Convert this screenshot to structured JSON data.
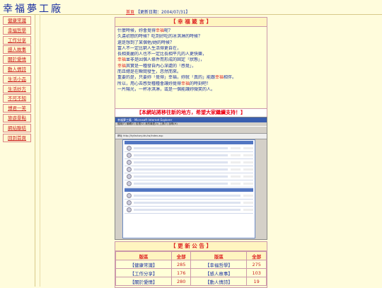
{
  "site": {
    "title": "幸福夢工廠"
  },
  "topbar": {
    "label": "首頁",
    "update": "【更新日期：2004/07/31】"
  },
  "sidebar": {
    "items": [
      {
        "label": "健康常識"
      },
      {
        "label": "幸福哲學"
      },
      {
        "label": "工作分享"
      },
      {
        "label": "感人故事"
      },
      {
        "label": "關於愛情"
      },
      {
        "label": "動人情詩"
      },
      {
        "label": "生活小品"
      },
      {
        "label": "生活妙方"
      },
      {
        "label": "不可不知"
      },
      {
        "label": "博君一笑"
      },
      {
        "label": "旅遊景點"
      },
      {
        "label": "網站聯結"
      },
      {
        "label": "回到首頁"
      }
    ]
  },
  "saying": {
    "title": "【 幸 福 箴 言 】",
    "lines": [
      [
        "什麼時候，妳會覺得",
        "幸福",
        "呢？"
      ],
      [
        "久違初戀的時候？吃到好吃的冰淇淋的時候？",
        "",
        ""
      ],
      [
        "還是想到了某個他/她的時候？",
        "",
        ""
      ],
      [
        "富人不一定比窮人生活得更自在，",
        "",
        ""
      ],
      [
        "長相美麗的人也不一定比長相平凡的人更快樂，",
        "",
        ""
      ],
      [
        "",
        "幸福",
        "並非是因個人條件而形成的固定「狀態」，"
      ],
      [
        "",
        "幸福",
        "其實是一種發自內心深處的「感覺」，"
      ],
      [
        "而且總是在瞬間發生，忽然而來。",
        "",
        ""
      ],
      [
        "重要的是，只要妳「覺得」幸福，妳就「真的」能跟",
        "幸福",
        "相伴。"
      ],
      [
        "所以，用心去感受種種會讓妳覺得",
        "幸福",
        "的時刻吧！"
      ],
      [
        "一片陽光，一杯冰淇淋，或是一個能讓妳微笑的人。",
        "",
        ""
      ]
    ]
  },
  "notice": {
    "moved": "【本網站將移往新的地方，希望大家繼續支持！】"
  },
  "browser": {
    "title": "幸福夢工廠 - Microsoft Internet Explorer",
    "menu": "檔案(F)  編輯(E)  檢視(V)  我的最愛(A)  工具(T)  說明(H)",
    "address": "網址 http://hyfactory.idv.tw/index.asp"
  },
  "announce": {
    "title": "【 更 新 公 告 】",
    "headers": [
      "版區",
      "全部",
      "版區",
      "全部"
    ],
    "rows": [
      [
        "【健康常識】",
        "285",
        "【幸福哲學】",
        "275"
      ],
      [
        "【工作分享】",
        "176",
        "【感人故事】",
        "103"
      ],
      [
        "【關於愛情】",
        "280",
        "【動人情詩】",
        "19"
      ]
    ]
  }
}
